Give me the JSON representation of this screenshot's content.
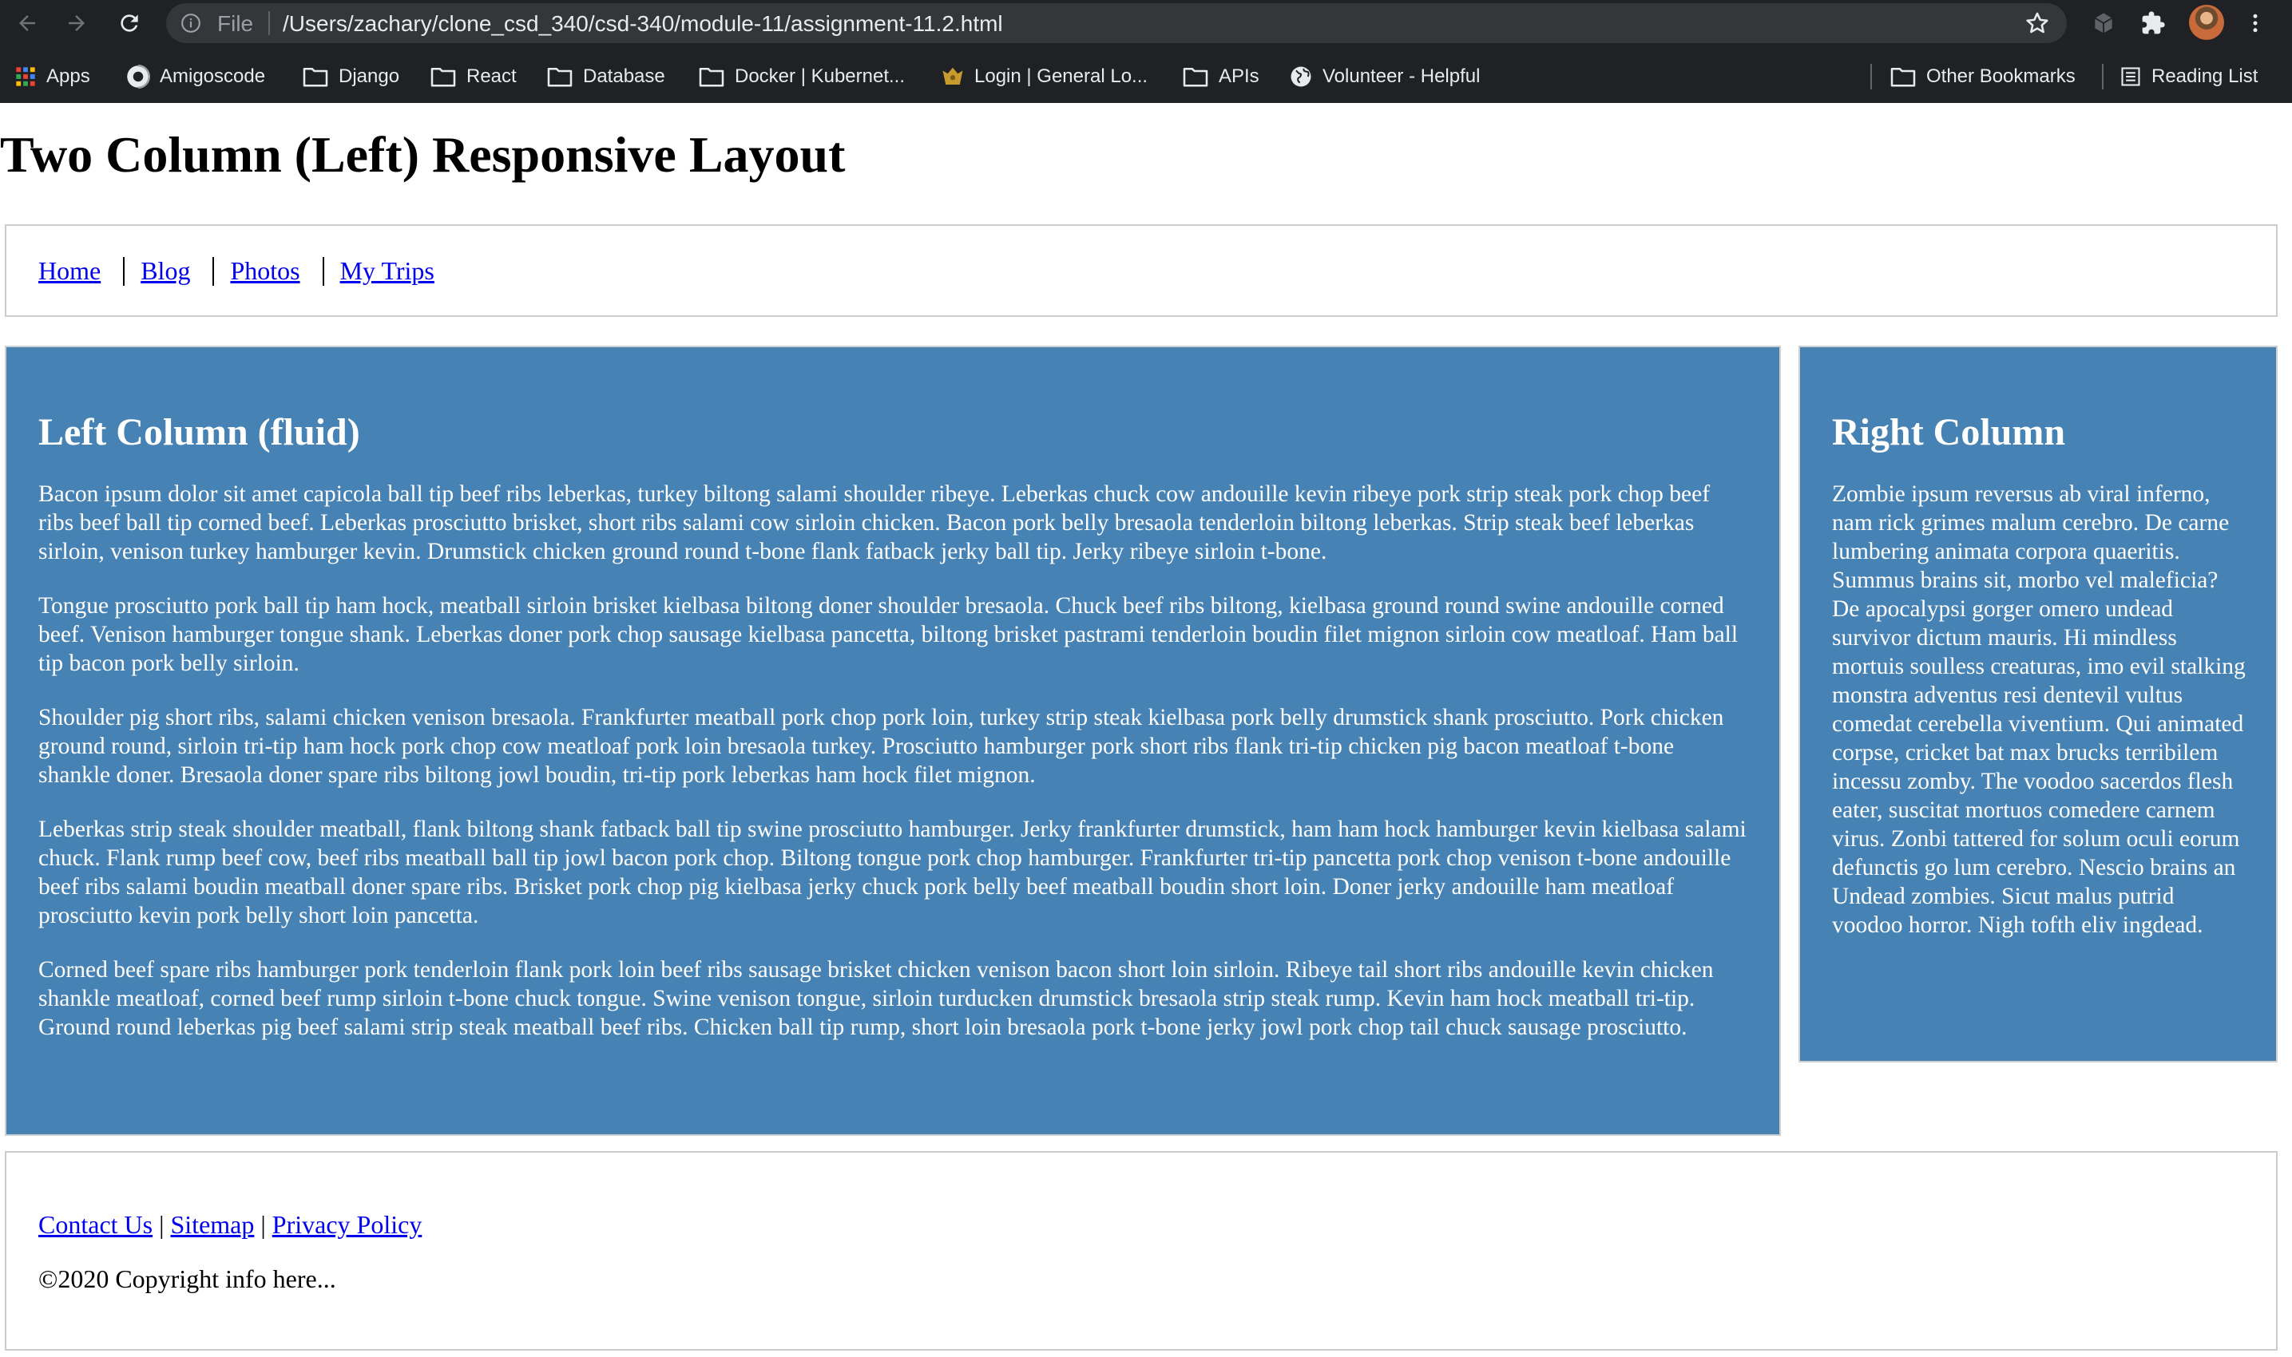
{
  "browser": {
    "address_scheme": "File",
    "address_url": "/Users/zachary/clone_csd_340/csd-340/module-11/assignment-11.2.html",
    "bookmarks": [
      {
        "label": "Apps",
        "icon": "apps-grid-icon"
      },
      {
        "label": "Amigoscode",
        "icon": "amigoscode-icon"
      },
      {
        "label": "Django",
        "icon": "folder-icon"
      },
      {
        "label": "React",
        "icon": "folder-icon"
      },
      {
        "label": "Database",
        "icon": "folder-icon"
      },
      {
        "label": "Docker | Kubernet...",
        "icon": "folder-icon"
      },
      {
        "label": "Login | General Lo...",
        "icon": "login-site-icon"
      },
      {
        "label": "APIs",
        "icon": "folder-icon"
      },
      {
        "label": "Volunteer - Helpful",
        "icon": "globe-icon"
      }
    ],
    "other_bookmarks": "Other Bookmarks",
    "reading_list": "Reading List"
  },
  "page": {
    "title": "Two Column (Left) Responsive Layout",
    "nav": [
      "Home",
      "Blog",
      "Photos",
      "My Trips"
    ],
    "left_column": {
      "heading": "Left Column (fluid)",
      "paragraphs": [
        "Bacon ipsum dolor sit amet capicola ball tip beef ribs leberkas, turkey biltong salami shoulder ribeye. Leberkas chuck cow andouille kevin ribeye pork strip steak pork chop beef ribs beef ball tip corned beef. Leberkas prosciutto brisket, short ribs salami cow sirloin chicken. Bacon pork belly bresaola tenderloin biltong leberkas. Strip steak beef leberkas sirloin, venison turkey hamburger kevin. Drumstick chicken ground round t-bone flank fatback jerky ball tip. Jerky ribeye sirloin t-bone.",
        "Tongue prosciutto pork ball tip ham hock, meatball sirloin brisket kielbasa biltong doner shoulder bresaola. Chuck beef ribs biltong, kielbasa ground round swine andouille corned beef. Venison hamburger tongue shank. Leberkas doner pork chop sausage kielbasa pancetta, biltong brisket pastrami tenderloin boudin filet mignon sirloin cow meatloaf. Ham ball tip bacon pork belly sirloin.",
        "Shoulder pig short ribs, salami chicken venison bresaola. Frankfurter meatball pork chop pork loin, turkey strip steak kielbasa pork belly drumstick shank prosciutto. Pork chicken ground round, sirloin tri-tip ham hock pork chop cow meatloaf pork loin bresaola turkey. Prosciutto hamburger pork short ribs flank tri-tip chicken pig bacon meatloaf t-bone shankle doner. Bresaola doner spare ribs biltong jowl boudin, tri-tip pork leberkas ham hock filet mignon.",
        "Leberkas strip steak shoulder meatball, flank biltong shank fatback ball tip swine prosciutto hamburger. Jerky frankfurter drumstick, ham ham hock hamburger kevin kielbasa salami chuck. Flank rump beef cow, beef ribs meatball ball tip jowl bacon pork chop. Biltong tongue pork chop hamburger. Frankfurter tri-tip pancetta pork chop venison t-bone andouille beef ribs salami boudin meatball doner spare ribs. Brisket pork chop pig kielbasa jerky chuck pork belly beef meatball boudin short loin. Doner jerky andouille ham meatloaf prosciutto kevin pork belly short loin pancetta.",
        "Corned beef spare ribs hamburger pork tenderloin flank pork loin beef ribs sausage brisket chicken venison bacon short loin sirloin. Ribeye tail short ribs andouille kevin chicken shankle meatloaf, corned beef rump sirloin t-bone chuck tongue. Swine venison tongue, sirloin turducken drumstick bresaola strip steak rump. Kevin ham hock meatball tri-tip. Ground round leberkas pig beef salami strip steak meatball beef ribs. Chicken ball tip rump, short loin bresaola pork t-bone jerky jowl pork chop tail chuck sausage prosciutto."
      ]
    },
    "right_column": {
      "heading": "Right Column",
      "paragraph": "Zombie ipsum reversus ab viral inferno, nam rick grimes malum cerebro. De carne lumbering animata corpora quaeritis. Summus brains sit, morbo vel maleficia? De apocalypsi gorger omero undead survivor dictum mauris. Hi mindless mortuis soulless creaturas, imo evil stalking monstra adventus resi dentevil vultus comedat cerebella viventium. Qui animated corpse, cricket bat max brucks terribilem incessu zomby. The voodoo sacerdos flesh eater, suscitat mortuos comedere carnem virus. Zonbi tattered for solum oculi eorum defunctis go lum cerebro. Nescio brains an Undead zombies. Sicut malus putrid voodoo horror. Nigh tofth eliv ingdead."
    },
    "footer": {
      "links": [
        "Contact Us",
        "Sitemap",
        "Privacy Policy"
      ],
      "separator": "|",
      "copyright": "©2020 Copyright info here..."
    },
    "colors": {
      "column_background": "#4682b4",
      "link": "#0000ee",
      "chrome_background": "#202124"
    }
  }
}
